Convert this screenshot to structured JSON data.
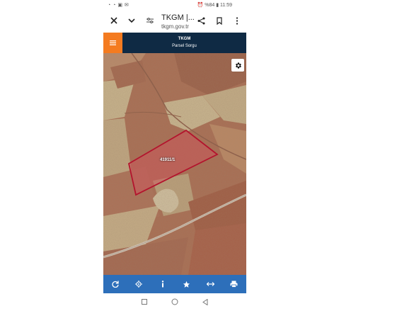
{
  "status_bar": {
    "left_icons": "◔ ◔ ▣ ✉",
    "right_text": "⏰ %84 ▮ 11:59"
  },
  "browser": {
    "close_icon": "close-icon",
    "dropdown_icon": "chevron-down-icon",
    "site_settings_icon": "tune-icon",
    "title": "TKGM |...",
    "url": "tkgm.gov.tr",
    "share_icon": "share-icon",
    "bookmark_icon": "bookmark-icon",
    "more_icon": "more-vert-icon"
  },
  "app": {
    "title": "TKGM",
    "subtitle": "Parsel Sorgu",
    "menu_icon": "hamburger-icon",
    "menu_color": "#f47b20",
    "header_color": "#0f2a44"
  },
  "map": {
    "parcel_label": "41911/1",
    "parcel_color": "#b3142d",
    "settings_icon": "gear-icon"
  },
  "bottom_toolbar": {
    "color": "#2d6fba",
    "items": [
      "refresh-icon",
      "locate-icon",
      "info-icon",
      "star-icon",
      "measure-icon",
      "print-icon"
    ]
  },
  "nav_bar": {
    "items": [
      "recent-apps-icon",
      "home-icon",
      "back-icon"
    ]
  }
}
